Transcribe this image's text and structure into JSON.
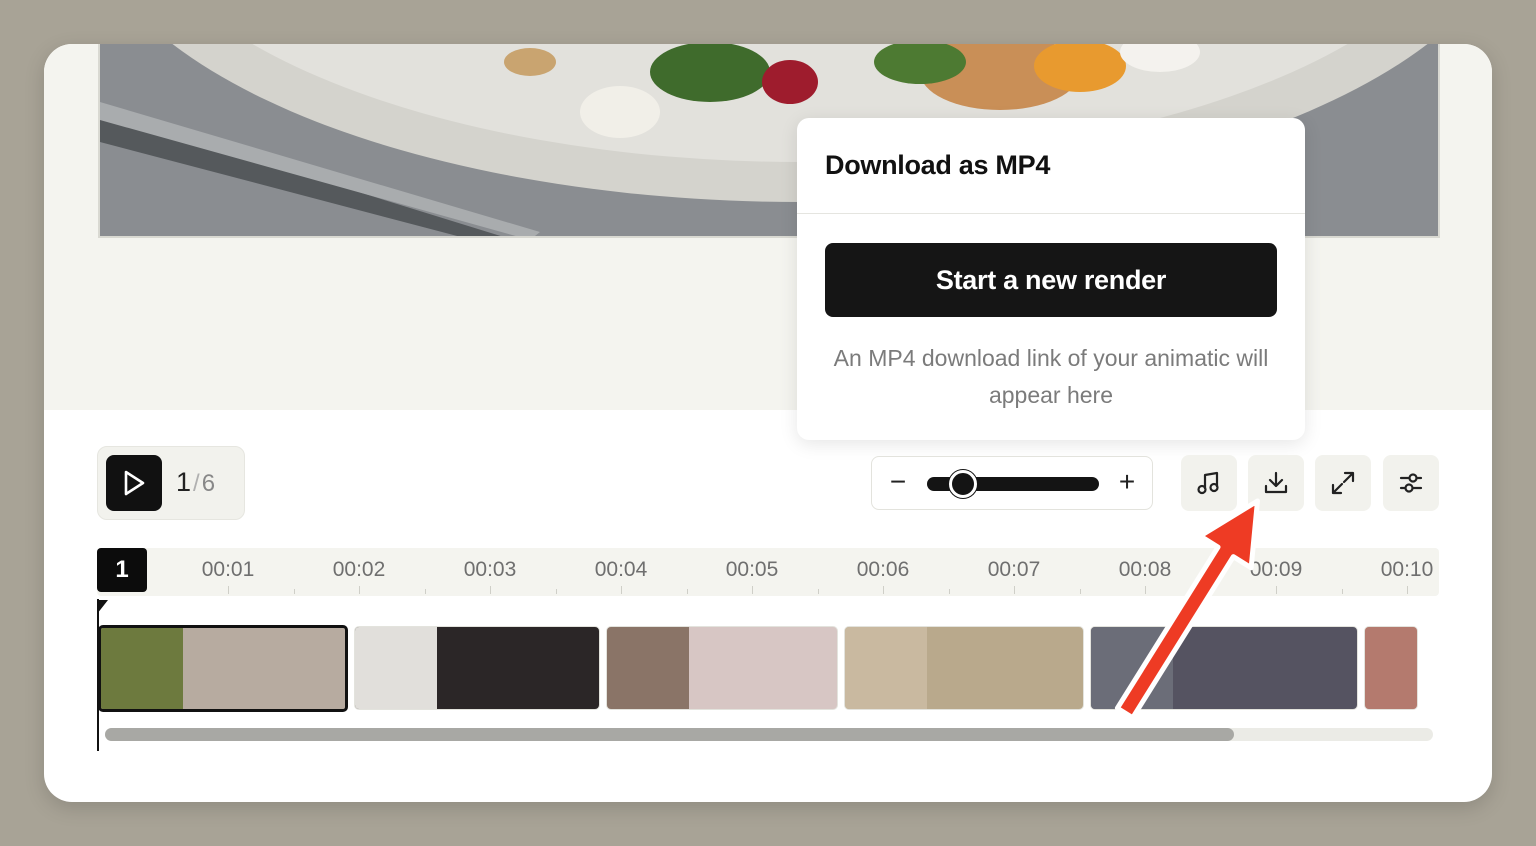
{
  "popover": {
    "title": "Download as MP4",
    "button_label": "Start a new render",
    "description": "An MP4 download link of your animatic will appear here"
  },
  "playback": {
    "current": "1",
    "separator": "/",
    "total": "6"
  },
  "zoom": {
    "minus": "−",
    "plus": "+",
    "value_fraction": 0.15
  },
  "toolbar": {
    "music_icon": "music-note-icon",
    "download_icon": "download-icon",
    "fullscreen_icon": "expand-icon",
    "settings_icon": "sliders-icon"
  },
  "timeline": {
    "scene_badge": "1",
    "ticks": [
      "00:01",
      "00:02",
      "00:03",
      "00:04",
      "00:05",
      "00:06",
      "00:07",
      "00:08",
      "00:09",
      "00:10"
    ],
    "scroll_fraction": 0.85
  },
  "colors": {
    "accent_dark": "#111111",
    "annotation_arrow": "#ee3b24"
  },
  "clips": [
    {
      "bg": "#b7aba0",
      "thumb": "#6d7a3e",
      "selected": true
    },
    {
      "bg": "#2b2627",
      "thumb": "#e1dfdb",
      "selected": false
    },
    {
      "bg": "#d7c6c4",
      "thumb": "#8a7467",
      "selected": false
    },
    {
      "bg": "#b9a98c",
      "thumb": "#c9b9a0",
      "selected": false
    },
    {
      "bg": "#555361",
      "thumb": "#6b6d78",
      "selected": false
    },
    {
      "bg": "#c9a5a1",
      "thumb": "#b47a6e",
      "selected": false
    }
  ]
}
